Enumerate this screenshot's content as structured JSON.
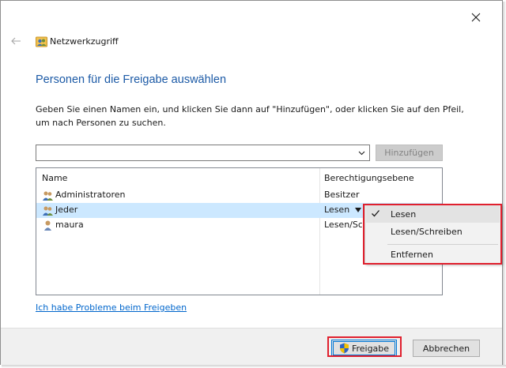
{
  "window": {
    "title": "Netzwerkzugriff",
    "close_icon": "close-icon",
    "back_icon": "back-arrow-icon",
    "title_icon": "network-share-icon"
  },
  "page": {
    "heading": "Personen für die Freigabe auswählen",
    "instructions": "Geben Sie einen Namen ein, und klicken Sie dann auf \"Hinzufügen\", oder klicken Sie auf den Pfeil, um nach Personen zu suchen."
  },
  "name_input": {
    "value": "",
    "placeholder": "",
    "dropdown_icon": "chevron-down-icon"
  },
  "add_button": {
    "label": "Hinzufügen",
    "enabled": false
  },
  "table": {
    "columns": [
      "Name",
      "Berechtigungsebene"
    ],
    "rows": [
      {
        "name": "Administratoren",
        "permission": "Besitzer",
        "icon": "user-group-icon"
      },
      {
        "name": "Jeder",
        "permission": "Lesen",
        "icon": "user-group-icon",
        "selected": true
      },
      {
        "name": "maura",
        "permission": "Lesen/Sc",
        "icon": "user-icon"
      }
    ]
  },
  "permission_menu": {
    "items": [
      {
        "label": "Lesen",
        "checked": true
      },
      {
        "label": "Lesen/Schreiben",
        "checked": false
      },
      {
        "label": "Entfernen",
        "checked": false
      }
    ]
  },
  "help_link": {
    "label": "Ich habe Probleme beim Freigeben"
  },
  "footer": {
    "share_label": "Freigabe",
    "share_icon": "uac-shield-icon",
    "cancel_label": "Abbrechen"
  },
  "colors": {
    "heading": "#1c5aa6",
    "link": "#0066cc",
    "selection": "#cce8ff",
    "highlight": "#e0202e",
    "accent": "#0078d7"
  }
}
